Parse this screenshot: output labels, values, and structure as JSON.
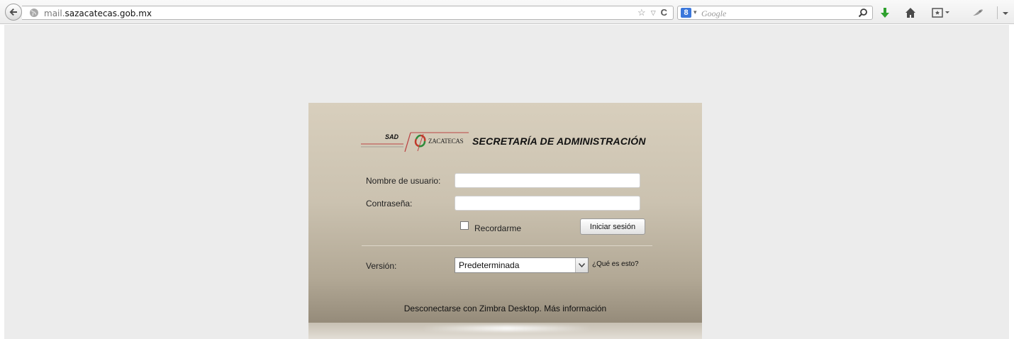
{
  "browser": {
    "url_prefix": "mail.",
    "url_domain": "sazacatecas.gob.mx",
    "search_engine_letter": "8",
    "search_placeholder": "Google"
  },
  "login": {
    "logo_small_text": "SAD",
    "logo_brand_text": "ZACATECAS",
    "org_title": "SECRETARÍA DE ADMINISTRACIÓN",
    "username_label": "Nombre de usuario:",
    "username_value": "",
    "password_label": "Contraseña:",
    "password_value": "",
    "remember_label": "Recordarme",
    "remember_checked": false,
    "login_button": "Iniciar sesión",
    "version_label": "Versión:",
    "version_selected": "Predeterminada",
    "help_link": "¿Qué es esto?",
    "footer_text": "Desconectarse con Zimbra Desktop.",
    "footer_link": "Más información"
  },
  "colors": {
    "panel_top": "#d8cfbd",
    "panel_bottom": "#958b7a",
    "download_arrow": "#2fa12f"
  }
}
